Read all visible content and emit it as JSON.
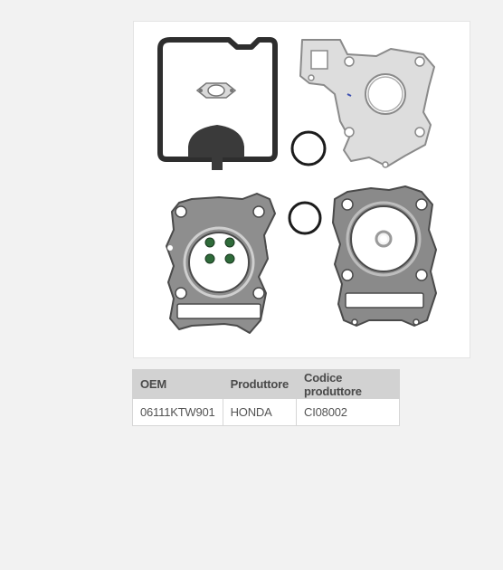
{
  "product_image": {
    "icon": "gasket-kit-photo",
    "colors": {
      "gasket_metal": "#9a9a9a",
      "gasket_dark": "#3a3a3a",
      "valve_seal": "#2f6b3a",
      "oring": "#1c1c1c"
    }
  },
  "table": {
    "headers": [
      "OEM",
      "Produttore",
      "Codice produttore"
    ],
    "rows": [
      [
        "06111KTW901",
        "HONDA",
        "CI08002"
      ]
    ]
  }
}
